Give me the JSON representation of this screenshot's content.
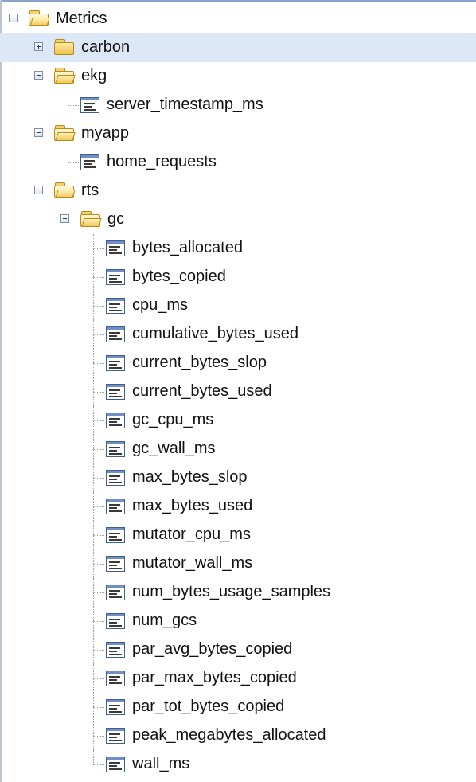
{
  "tree": {
    "root": {
      "label": "Metrics",
      "expanded": true,
      "icon": "open-folder-icon"
    },
    "carbon": {
      "label": "carbon",
      "expanded": false,
      "selected": true,
      "icon": "folder-icon"
    },
    "ekg": {
      "label": "ekg",
      "expanded": true,
      "icon": "open-folder-icon",
      "children": [
        "server_timestamp_ms"
      ]
    },
    "myapp": {
      "label": "myapp",
      "expanded": true,
      "icon": "open-folder-icon",
      "children": [
        "home_requests"
      ]
    },
    "rts": {
      "label": "rts",
      "expanded": true,
      "icon": "open-folder-icon"
    },
    "gc": {
      "label": "gc",
      "expanded": true,
      "icon": "open-folder-icon",
      "children": [
        "bytes_allocated",
        "bytes_copied",
        "cpu_ms",
        "cumulative_bytes_used",
        "current_bytes_slop",
        "current_bytes_used",
        "gc_cpu_ms",
        "gc_wall_ms",
        "max_bytes_slop",
        "max_bytes_used",
        "mutator_cpu_ms",
        "mutator_wall_ms",
        "num_bytes_usage_samples",
        "num_gcs",
        "par_avg_bytes_copied",
        "par_max_bytes_copied",
        "par_tot_bytes_copied",
        "peak_megabytes_allocated",
        "wall_ms"
      ]
    }
  },
  "colors": {
    "selection": "#dce8f7",
    "folder": "#f0c453",
    "leaf_header": "#6f8fc6"
  }
}
